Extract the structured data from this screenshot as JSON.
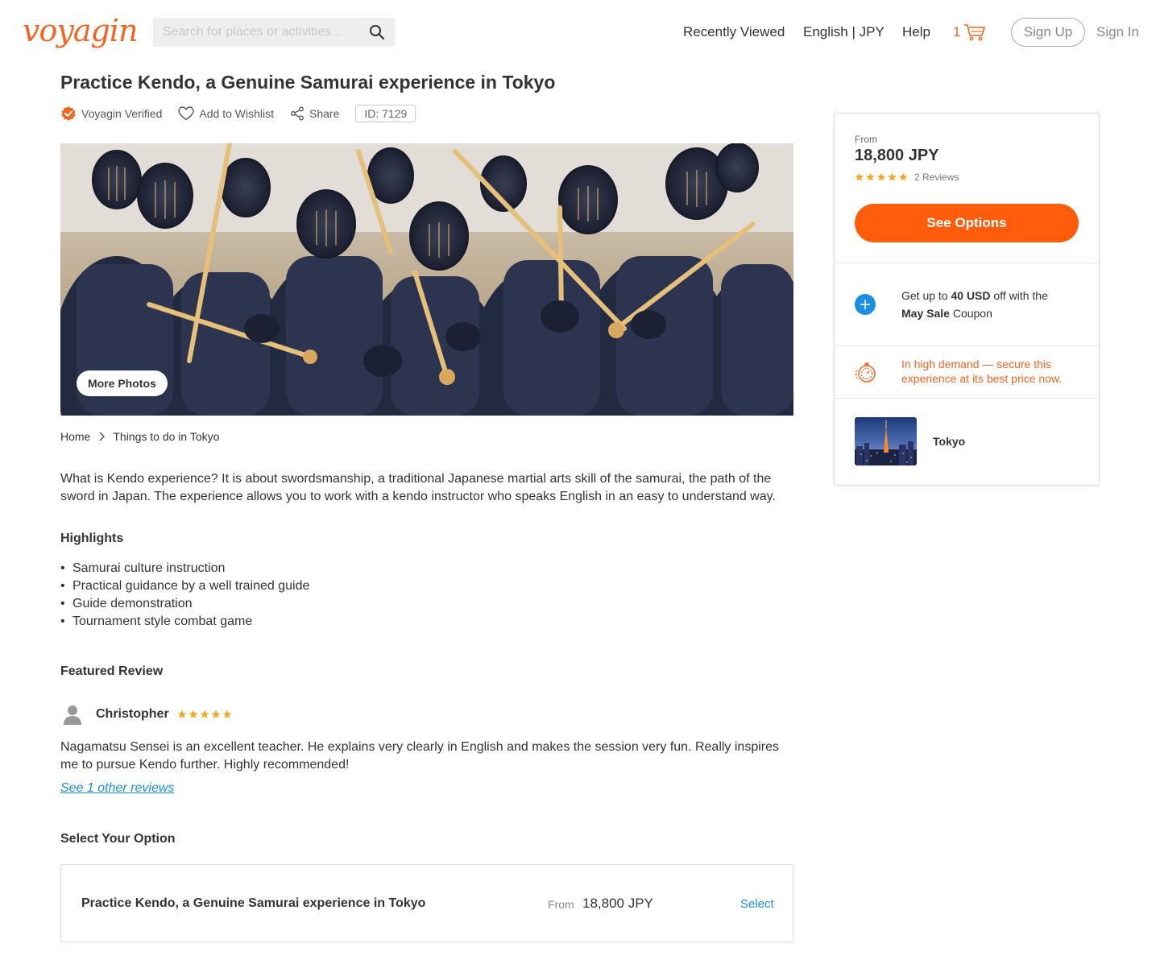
{
  "header": {
    "logo": "voyagin",
    "search_placeholder": "Search for places or activities...",
    "nav": {
      "recently_viewed": "Recently Viewed",
      "language": "English | JPY",
      "help": "Help"
    },
    "cart_count": "1",
    "sign_up": "Sign Up",
    "sign_in": "Sign In"
  },
  "activity": {
    "title": "Practice Kendo, a Genuine Samurai experience in Tokyo",
    "verified": "Voyagin Verified",
    "wishlist": "Add to Wishlist",
    "share": "Share",
    "id": "ID: 7129",
    "more_photos": "More Photos"
  },
  "breadcrumb": [
    "Home",
    "Things to do in Tokyo"
  ],
  "description": "What is Kendo experience? It is about swordsmanship, a traditional Japanese martial arts skill of the samurai, the path of the sword in Japan. The experience allows you to work with a kendo instructor who speaks English in an easy to understand way.",
  "highlights": {
    "title": "Highlights",
    "items": [
      "Samurai culture instruction",
      "Practical guidance by a well trained guide",
      "Guide demonstration",
      "Tournament style combat game"
    ]
  },
  "featured_review": {
    "title": "Featured Review",
    "reviewer": "Christopher",
    "rating": 5,
    "text": "Nagamatsu Sensei is an excellent teacher. He explains very clearly in English and makes the session very fun. Really inspires me to pursue Kendo further. Highly recommended!",
    "see_more": "See 1 other reviews"
  },
  "options": {
    "title": "Select Your Option",
    "items": [
      {
        "name": "Practice Kendo, a Genuine Samurai experience in Tokyo",
        "from": "From",
        "price": "18,800 JPY",
        "select": "Select"
      }
    ]
  },
  "sidebar": {
    "from": "From",
    "price": "18,800 JPY",
    "rating": 5,
    "reviews": "2 Reviews",
    "button": "See Options",
    "coupon_pre": "Get up to ",
    "coupon_amount": "40 USD",
    "coupon_mid": " off with the",
    "coupon_name": "May Sale",
    "coupon_post": " Coupon",
    "demand": "In high demand — secure this experience at its best price now.",
    "city": "Tokyo"
  },
  "colors": {
    "brand": "#f26522",
    "button": "#ff5d0c",
    "link": "#1a8fe3",
    "star": "#f5a623"
  }
}
